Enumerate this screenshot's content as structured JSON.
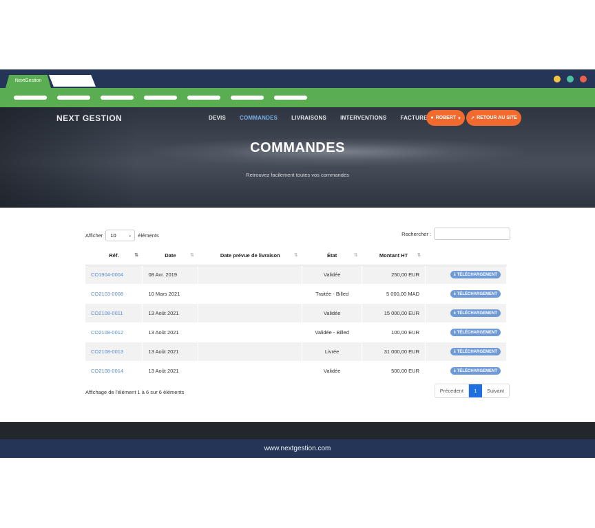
{
  "window": {
    "tab_label": "NextGestion",
    "dot_colors": [
      "#f4c542",
      "#4bc1a2",
      "#e8604d"
    ]
  },
  "header": {
    "brand": "NEXT GESTION",
    "nav": [
      {
        "label": "DEVIS",
        "active": false
      },
      {
        "label": "COMMANDES",
        "active": true
      },
      {
        "label": "LIVRAISONS",
        "active": false
      },
      {
        "label": "INTERVENTIONS",
        "active": false
      },
      {
        "label": "FACTURES",
        "active": false
      }
    ],
    "user_button": "ROBERT",
    "back_button": "RETOUR AU SITE",
    "accent": "#f26a2e"
  },
  "hero": {
    "title": "COMMANDES",
    "subtitle": "Retrouvez facilement toutes vos commandes"
  },
  "table_controls": {
    "show_label": "Afficher",
    "page_size": "10",
    "entries_label": "éléments",
    "search_label": "Rechercher :"
  },
  "table": {
    "columns": [
      "Réf.",
      "Date",
      "Date prévue de livraison",
      "État",
      "Montant HT",
      ""
    ],
    "rows": [
      {
        "ref": "CO1904-0004",
        "date": "08 Avr. 2019",
        "delivery": "",
        "state": "Validée",
        "amount": "250,00 EUR",
        "action": "TÉLÉCHARGEMENT"
      },
      {
        "ref": "CO2103-0008",
        "date": "10 Mars 2021",
        "delivery": "",
        "state": "Traitée - Billed",
        "amount": "5 000,00 MAD",
        "action": "TÉLÉCHARGEMENT"
      },
      {
        "ref": "CO2108-0011",
        "date": "13 Août 2021",
        "delivery": "",
        "state": "Validée",
        "amount": "15 000,00 EUR",
        "action": "TÉLÉCHARGEMENT"
      },
      {
        "ref": "CO2108-0012",
        "date": "13 Août 2021",
        "delivery": "",
        "state": "Validée - Billed",
        "amount": "100,00 EUR",
        "action": "TÉLÉCHARGEMENT"
      },
      {
        "ref": "CO2108-0013",
        "date": "13 Août 2021",
        "delivery": "",
        "state": "Livrée",
        "amount": "31 000,00 EUR",
        "action": "TÉLÉCHARGEMENT"
      },
      {
        "ref": "CO2108-0014",
        "date": "13 Août 2021",
        "delivery": "",
        "state": "Validée",
        "amount": "500,00 EUR",
        "action": "TÉLÉCHARGEMENT"
      }
    ]
  },
  "pagination": {
    "info": "Affichage de l'élément 1 à 6 sur 6 éléments",
    "prev": "Précedent",
    "current": "1",
    "next": "Suivant"
  },
  "footer": {
    "url": "www.nextgestion.com"
  }
}
